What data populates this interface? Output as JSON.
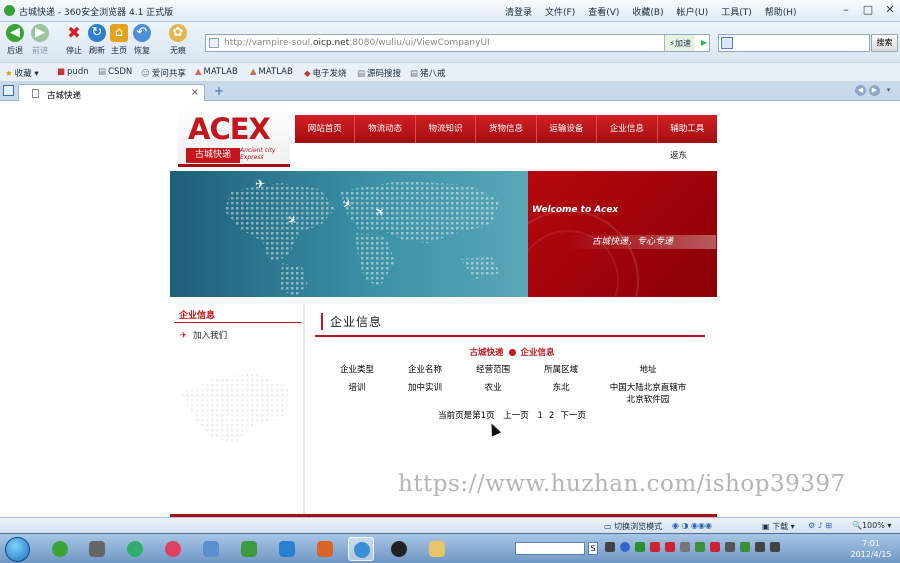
{
  "window": {
    "title": "古城快递 - 360安全浏览器 4.1 正式版",
    "menu": [
      "清登录",
      "文件(F)",
      "查看(V)",
      "收藏(B)",
      "帐户(U)",
      "工具(T)",
      "帮助(H)"
    ]
  },
  "toolbar": {
    "buttons": [
      "后退",
      "前进",
      "停止",
      "刷新",
      "主页",
      "恢复",
      "无痕"
    ],
    "address_prefix": "http://vampire-soul.",
    "address_host": "oicp.net",
    "address_suffix": ":8080/wuliu/ui/ViewCompanyUI",
    "speed_label": "加速",
    "search_button": "搜索"
  },
  "favorites": [
    "收藏",
    "pudn",
    "CSDN",
    "爱问共享",
    "MATLAB",
    "MATLAB",
    "电子发烧",
    "源码搜搜",
    "猪八戒"
  ],
  "tab": {
    "label": "古城快递"
  },
  "site": {
    "logo_text": "ACEX",
    "logo_cn": "古城快递",
    "logo_en_1": "Ancient city",
    "logo_en_2": "Express",
    "nav": [
      "网站首页",
      "物流动态",
      "物流知识",
      "货物信息",
      "运输设备",
      "企业信息",
      "辅助工具"
    ],
    "subnav": "返东",
    "banner_welcome": "Welcome to  Acex",
    "banner_slogan": "古城快递，专心专递",
    "sidebar_title": "企业信息",
    "sidebar_item": "加入我们",
    "main_title": "企业信息",
    "crumb_left": "古城快递",
    "crumb_right": "企业信息",
    "table": {
      "headers": [
        "企业类型",
        "企业名称",
        "经营范围",
        "所属区域",
        "地址"
      ],
      "rows": [
        [
          "培训",
          "加中实训",
          "农业",
          "东北",
          "中国大陆北京直辖市北京软件园"
        ]
      ]
    },
    "pager": {
      "text": "当前页是第1页",
      "prev": "上一页",
      "pages": [
        "1",
        "2"
      ],
      "next": "下一页"
    },
    "watermark": "https://www.huzhan.com/ishop39397"
  },
  "statusbar": {
    "mode": "切换浏览模式",
    "download": "下载",
    "zoom": "100%"
  },
  "clock": {
    "time": "7:01",
    "date": "2012/4/15"
  },
  "colors": {
    "brand_red": "#c4161c",
    "nav_red": "#b3141a",
    "banner_teal": "#2f7f98"
  }
}
